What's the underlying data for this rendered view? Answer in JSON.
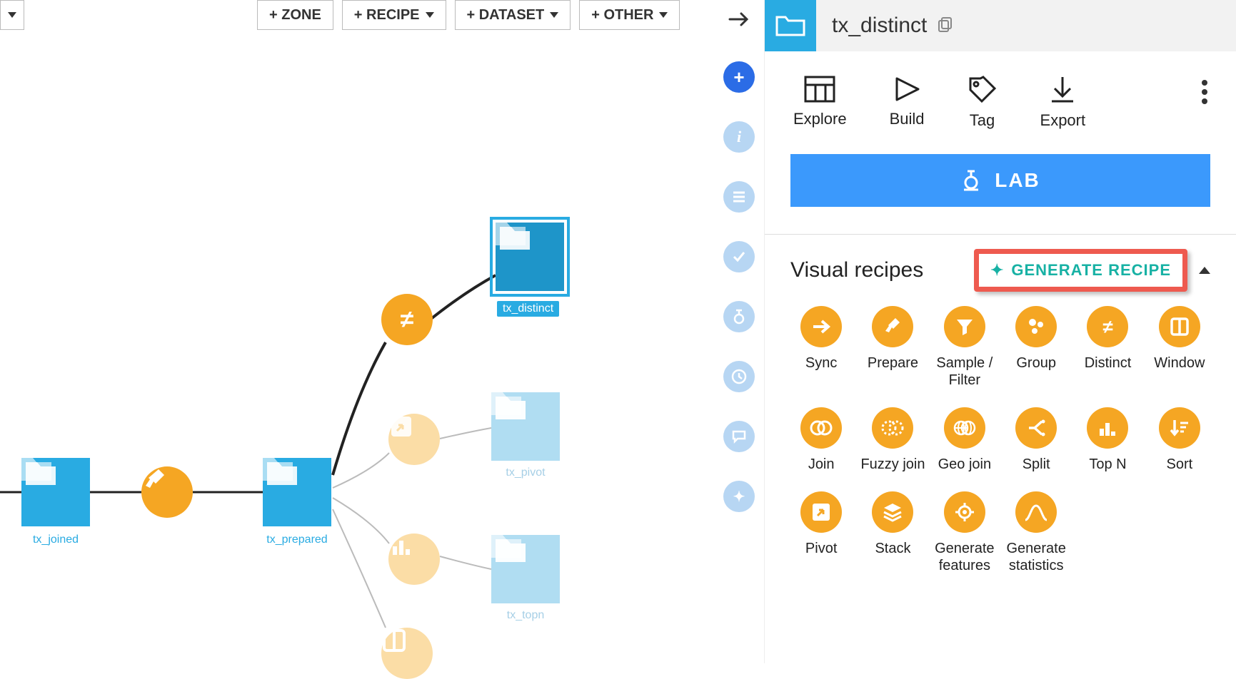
{
  "toolbar": {
    "zone": "+ ZONE",
    "recipe": "+ RECIPE",
    "dataset": "+ DATASET",
    "other": "+ OTHER"
  },
  "flow": {
    "datasets": {
      "tx_joined": "tx_joined",
      "tx_prepared": "tx_prepared",
      "tx_distinct": "tx_distinct",
      "tx_pivot": "tx_pivot",
      "tx_topn": "tx_topn"
    }
  },
  "panel": {
    "title": "tx_distinct",
    "actions": {
      "explore": "Explore",
      "build": "Build",
      "tag": "Tag",
      "export": "Export"
    },
    "lab": "LAB",
    "section_title": "Visual recipes",
    "generate": "GENERATE RECIPE",
    "recipes": {
      "sync": "Sync",
      "prepare": "Prepare",
      "sample": "Sample / Filter",
      "group": "Group",
      "distinct": "Distinct",
      "window": "Window",
      "join": "Join",
      "fuzzy": "Fuzzy join",
      "geo": "Geo join",
      "split": "Split",
      "topn": "Top N",
      "sort": "Sort",
      "pivot": "Pivot",
      "stack": "Stack",
      "genfeat": "Generate features",
      "genstat": "Generate statistics"
    }
  }
}
